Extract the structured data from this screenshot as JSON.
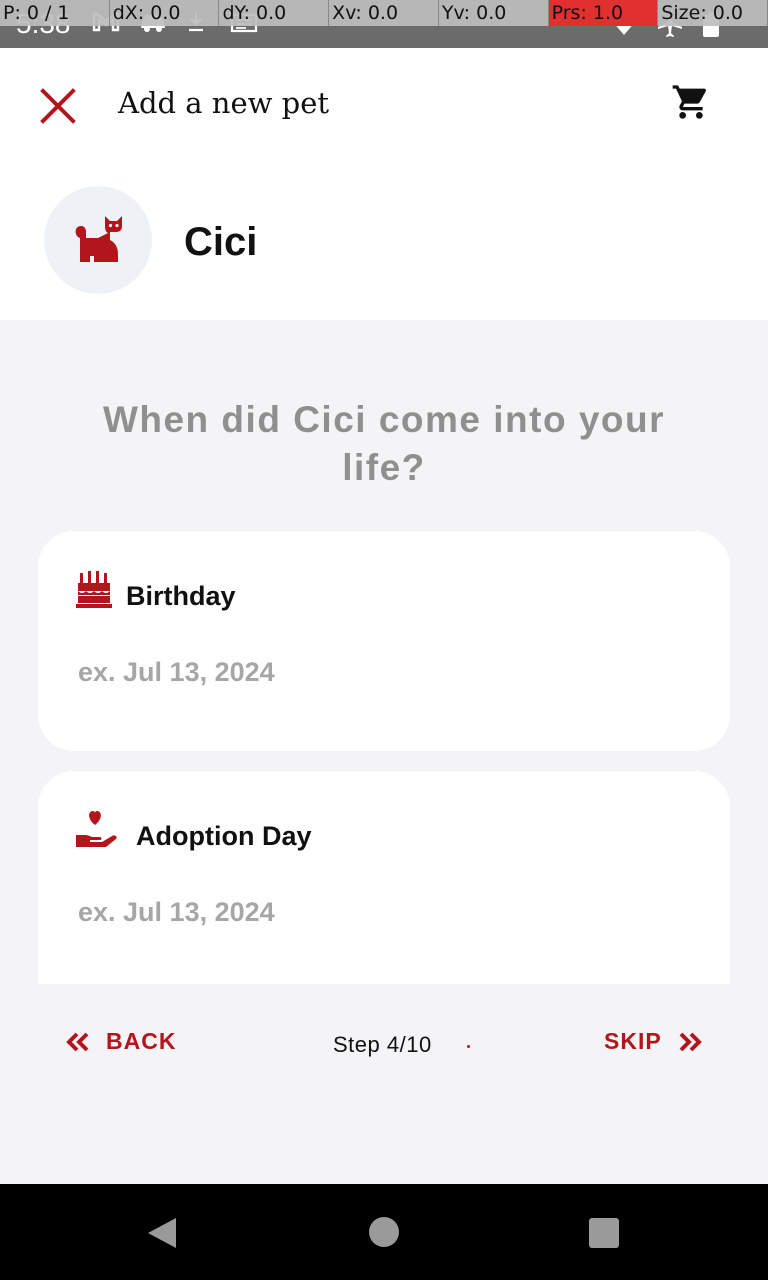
{
  "status_bar": {
    "time": "5:38"
  },
  "debug_overlay": {
    "pointer": "P: 0 / 1",
    "dx": "dX: 0.0",
    "dy": "dY: 0.0",
    "xv": "Xv: 0.0",
    "yv": "Yv: 0.0",
    "prs": "Prs: 1.0",
    "size": "Size: 0.0",
    "highlight_color": "#e03030"
  },
  "app_bar": {
    "title": "Add a new pet",
    "close_icon": "close-icon",
    "cart_icon": "shopping-cart-icon"
  },
  "pet": {
    "name": "Cici",
    "avatar_icon": "cat-icon"
  },
  "question": "When did Cici come into your life?",
  "fields": {
    "birthday": {
      "label": "Birthday",
      "placeholder": "ex. Jul 13, 2024",
      "value": "",
      "icon": "birthday-cake-icon"
    },
    "adoption_day": {
      "label": "Adoption Day",
      "placeholder": "ex. Jul 13, 2024",
      "value": "",
      "icon": "heart-hand-icon"
    }
  },
  "footer": {
    "back_label": "BACK",
    "skip_label": "SKIP",
    "step_label": "Step 4/10",
    "step_current": 4,
    "step_total": 10
  },
  "colors": {
    "accent": "#b3151d",
    "background": "#f4f4f6",
    "card": "#ffffff",
    "question_text": "#8f8f8f",
    "placeholder_text": "#a6a6a6",
    "avatar_bg": "#eef2f6"
  }
}
